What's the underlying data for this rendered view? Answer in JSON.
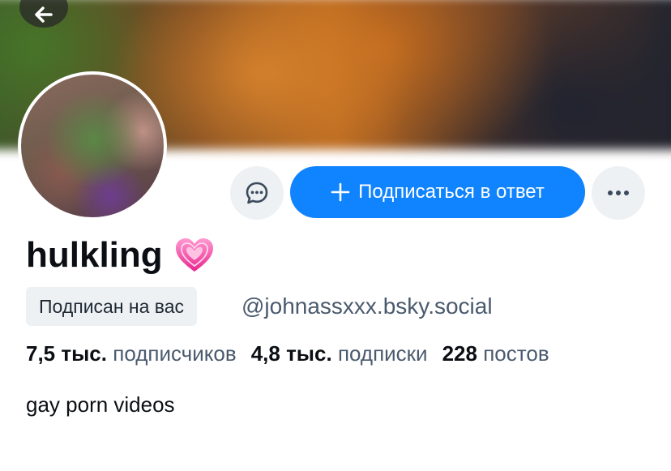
{
  "profile": {
    "display_name": "hulkling",
    "name_emoji": "heart-sparkle-icon",
    "follows_you_badge": "Подписан на вас",
    "handle": "@johnassxxx.bsky.social",
    "bio": "gay porn videos"
  },
  "actions": {
    "message_icon": "chat-bubble-icon",
    "follow_back_label": "Подписаться в ответ",
    "more_icon": "more-dots-icon",
    "back_icon": "back-arrow-icon"
  },
  "stats": [
    {
      "value": "7,5 тыс.",
      "label": "подписчиков"
    },
    {
      "value": "4,8 тыс.",
      "label": "подписки"
    },
    {
      "value": "228",
      "label": "постов"
    }
  ],
  "colors": {
    "accent": "#1083fe",
    "secondary_text": "#4a5a6e",
    "button_bg": "#eef1f4"
  }
}
